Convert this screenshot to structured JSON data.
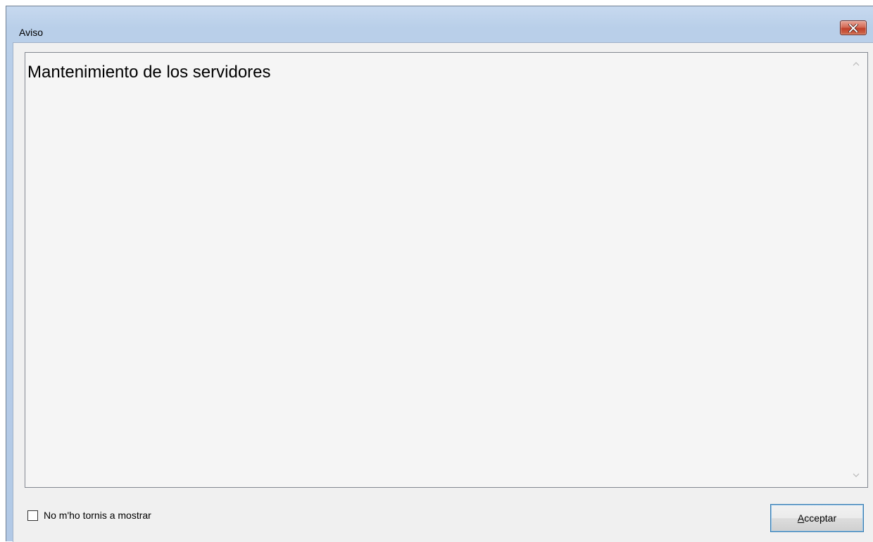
{
  "window": {
    "title": "Aviso"
  },
  "message": {
    "text": "Mantenimiento de los servidores"
  },
  "footer": {
    "checkbox_label": "No m'ho tornis a mostrar",
    "checkbox_checked": false,
    "accept_mnemonic": "A",
    "accept_rest": "cceptar"
  },
  "icons": {
    "close": "close-icon",
    "scroll_up": "chevron-up-icon",
    "scroll_down": "chevron-down-icon"
  },
  "colors": {
    "titlebar": "#b9cfe9",
    "close_button": "#c0402a",
    "client_background": "#f0f0f0",
    "message_background": "#f5f5f5",
    "default_button_border": "#3c7fb1"
  }
}
